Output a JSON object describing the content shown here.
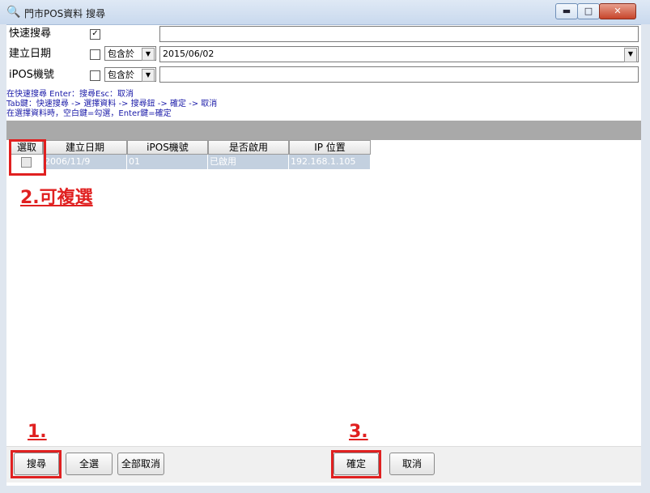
{
  "window": {
    "title": "門市POS資料 搜尋",
    "minimize": "▬",
    "maximize": "□",
    "close": "✕"
  },
  "filters": {
    "quick": {
      "label": "快速搜尋",
      "checked_mark": "✓",
      "value": ""
    },
    "date": {
      "label": "建立日期",
      "operator": "包含於",
      "value": "2015/06/02"
    },
    "ipos": {
      "label": "iPOS機號",
      "operator": "包含於",
      "value": ""
    }
  },
  "hints": [
    "在快速搜尋 Enter：搜尋Esc：取消",
    "Tab鍵：快速搜尋 -> 選擇資料 -> 搜尋鈕 -> 確定 -> 取消",
    "在選擇資料時，空白鍵=勾選，Enter鍵=確定"
  ],
  "grid": {
    "columns": [
      "選取",
      "建立日期",
      "iPOS機號",
      "是否啟用",
      "IP 位置"
    ],
    "rows": [
      {
        "date": "2006/11/9",
        "ipos": "01",
        "enabled": "已啟用",
        "ip": "192.168.1.105"
      }
    ]
  },
  "annotations": {
    "a1": "1.",
    "a2": "2.可複選",
    "a3": "3."
  },
  "buttons": {
    "search": "搜尋",
    "select_all": "全選",
    "clear_all": "全部取消",
    "ok": "確定",
    "cancel": "取消"
  },
  "colors": {
    "annotation_red": "#e02020",
    "selected_row": "#c3d0df",
    "hint_blue": "#1a1aa8"
  }
}
